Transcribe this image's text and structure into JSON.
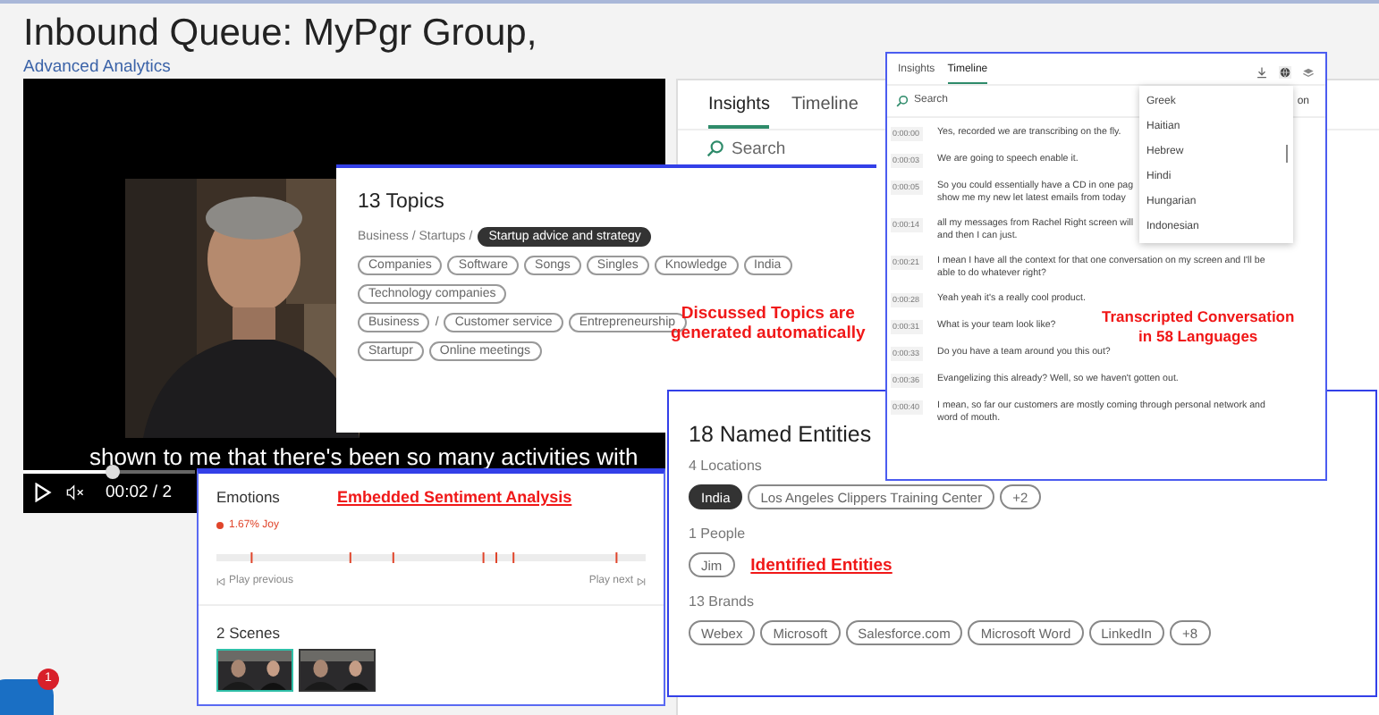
{
  "header": {
    "title": "Inbound Queue: MyPgr Group,",
    "link": "Advanced Analytics"
  },
  "video": {
    "kind": "picture",
    "subtitle": "shown to me that there's been so many activities with",
    "time": "00:02 / 2",
    "progress": {
      "level": 0.52
    }
  },
  "side_panel": {
    "tabs": [
      {
        "label": "Insights",
        "selected": true
      },
      {
        "label": "Timeline",
        "selected": false
      }
    ],
    "search": {
      "placeholder": "Search"
    }
  },
  "topics": {
    "title": "13 Topics",
    "breadcrumb": {
      "path": "Business / Startups /",
      "current": "Startup advice and strategy"
    },
    "rows": [
      [
        {
          "kind": "chip",
          "label": "Companies"
        },
        {
          "kind": "chip",
          "label": "Software"
        },
        {
          "kind": "chip",
          "label": "Songs"
        },
        {
          "kind": "chip",
          "label": "Singles"
        },
        {
          "kind": "chip",
          "label": "Knowledge"
        },
        {
          "kind": "chip",
          "label": "India"
        }
      ],
      [
        {
          "kind": "chip",
          "label": "Technology companies"
        }
      ],
      [
        {
          "kind": "chip",
          "label": "Business"
        },
        {
          "kind": "separator",
          "label": "/"
        },
        {
          "kind": "chip",
          "label": "Customer service"
        },
        {
          "kind": "chip",
          "label": "Entrepreneurship"
        }
      ],
      [
        {
          "kind": "chip",
          "label": "Startupr"
        },
        {
          "kind": "chip",
          "label": "Online meetings"
        }
      ]
    ],
    "annotation": [
      "Discussed Topics are",
      "generated automatically"
    ]
  },
  "transcript": {
    "tabs": [
      {
        "label": "Insights",
        "selected": false
      },
      {
        "label": "Timeline",
        "selected": true
      }
    ],
    "search": {
      "placeholder": "Search"
    },
    "search_suffix": "on",
    "languages": [
      {
        "label": "Greek"
      },
      {
        "label": "Haitian"
      },
      {
        "label": "Hebrew"
      },
      {
        "label": "Hindi"
      },
      {
        "label": "Hungarian"
      },
      {
        "label": "Indonesian"
      }
    ],
    "lines": [
      {
        "time": "0:00:00",
        "text": [
          "Yes, recorded we are transcribing on the fly."
        ]
      },
      {
        "time": "0:00:03",
        "text": [
          "We are going to speech enable it."
        ]
      },
      {
        "time": "0:00:05",
        "text": [
          "So you could essentially have a CD in one pag",
          "show me my new let latest emails from today"
        ]
      },
      {
        "time": "0:00:14",
        "text": [
          "all my messages from Rachel Right screen will",
          "and then I can just."
        ]
      },
      {
        "time": "0:00:21",
        "text": [
          "I mean I have all the context for that one conversation on my screen and I'll be",
          "able to do whatever right?"
        ]
      },
      {
        "time": "0:00:28",
        "text": [
          "Yeah yeah it's a really cool product."
        ]
      },
      {
        "time": "0:00:31",
        "text": [
          "What is your team look like?"
        ]
      },
      {
        "time": "0:00:33",
        "text": [
          "Do you have a team around you this out?"
        ]
      },
      {
        "time": "0:00:36",
        "text": [
          "Evangelizing this already? Well, so we haven't gotten out."
        ]
      },
      {
        "time": "0:00:40",
        "text": [
          "I mean, so far our customers are mostly coming through personal network and",
          "word of mouth."
        ]
      }
    ],
    "annotation": [
      "Transcripted Conversation",
      "in 58 Languages"
    ]
  },
  "entities": {
    "title": "18 Named Entities",
    "groups": [
      {
        "heading": "4 Locations",
        "chips": [
          {
            "label": "India",
            "selected": true
          },
          {
            "label": "Los Angeles Clippers Training Center",
            "selected": false
          },
          {
            "label": "+2",
            "selected": false
          }
        ]
      },
      {
        "heading": "1 People",
        "chips": [
          {
            "label": "Jim",
            "selected": false
          }
        ],
        "annotation": "Identified Entities"
      },
      {
        "heading": "13 Brands",
        "chips": [
          {
            "label": "Webex",
            "selected": false
          },
          {
            "label": "Microsoft",
            "selected": false
          },
          {
            "label": "Salesforce.com",
            "selected": false
          },
          {
            "label": "Microsoft Word",
            "selected": false
          },
          {
            "label": "LinkedIn",
            "selected": false
          },
          {
            "label": "+8",
            "selected": false
          }
        ]
      }
    ]
  },
  "emotions": {
    "title": "Emotions",
    "annotation": "Embedded Sentiment Analysis",
    "legend": {
      "label": "1.67% Joy",
      "color": "#e0452b"
    },
    "previous": "Play previous",
    "next": "Play next",
    "scenes_title": "2 Scenes",
    "scenes": [
      {
        "kind": "picture",
        "selected": true
      },
      {
        "kind": "picture",
        "selected": false
      }
    ]
  },
  "chat": {
    "badge": "1"
  }
}
